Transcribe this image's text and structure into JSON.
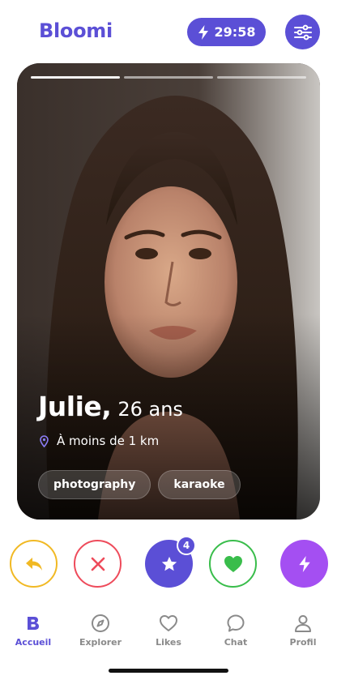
{
  "header": {
    "logo": "Bloomi",
    "boost_timer": "29:58",
    "icons": {
      "boost": "lightning-icon",
      "filter": "sliders-icon"
    }
  },
  "card": {
    "name": "Julie,",
    "age": "26 ans",
    "distance": "À moins de 1 km",
    "tags": [
      "photography",
      "karaoke"
    ],
    "photo_progress": {
      "total": 3,
      "current": 1
    }
  },
  "actions": {
    "super_like_count": "4",
    "icons": [
      "rewind-icon",
      "close-icon",
      "star-icon",
      "heart-icon",
      "lightning-icon"
    ]
  },
  "tabbar": {
    "items": [
      {
        "label": "Accueil",
        "icon": "bloomi-b-icon",
        "active": true
      },
      {
        "label": "Explorer",
        "icon": "compass-icon",
        "active": false
      },
      {
        "label": "Likes",
        "icon": "heart-outline-icon",
        "active": false
      },
      {
        "label": "Chat",
        "icon": "chat-bubble-icon",
        "active": false
      },
      {
        "label": "Profil",
        "icon": "person-icon",
        "active": false
      }
    ]
  },
  "colors": {
    "brand": "#5b4fd6",
    "rewind": "#f1b924",
    "nope": "#ee4b5b",
    "like": "#39bd4b",
    "boost": "#a44ff2"
  }
}
